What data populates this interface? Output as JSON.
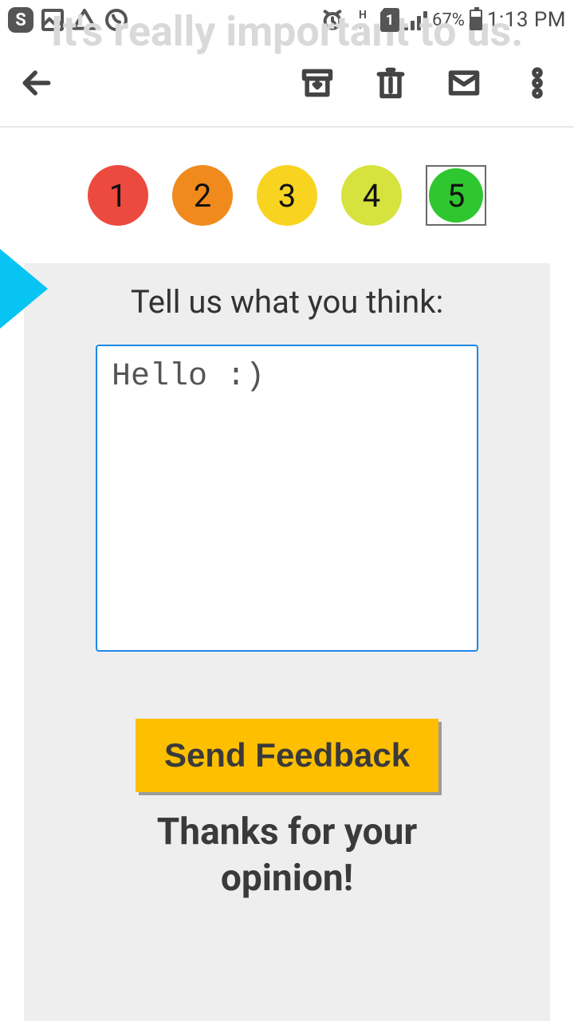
{
  "status_bar": {
    "battery_pct": "67%",
    "time": "1:13 PM",
    "data_label": "H",
    "sim_label": "1"
  },
  "ghost_title": "It's really important to us.",
  "app_bar": {
    "back": "Back",
    "archive": "Archive",
    "delete": "Delete",
    "mail": "Mail",
    "more": "More"
  },
  "rating": {
    "options": [
      "1",
      "2",
      "3",
      "4",
      "5"
    ],
    "colors": [
      "#ec4a3f",
      "#f08a1d",
      "#f8d421",
      "#d6e23e",
      "#2fc72f"
    ],
    "selected_index": 4
  },
  "feedback": {
    "prompt": "Tell us what you think:",
    "value": "Hello :)",
    "placeholder": "",
    "send_label": "Send Feedback",
    "thanks": "Thanks for your opinion!"
  }
}
